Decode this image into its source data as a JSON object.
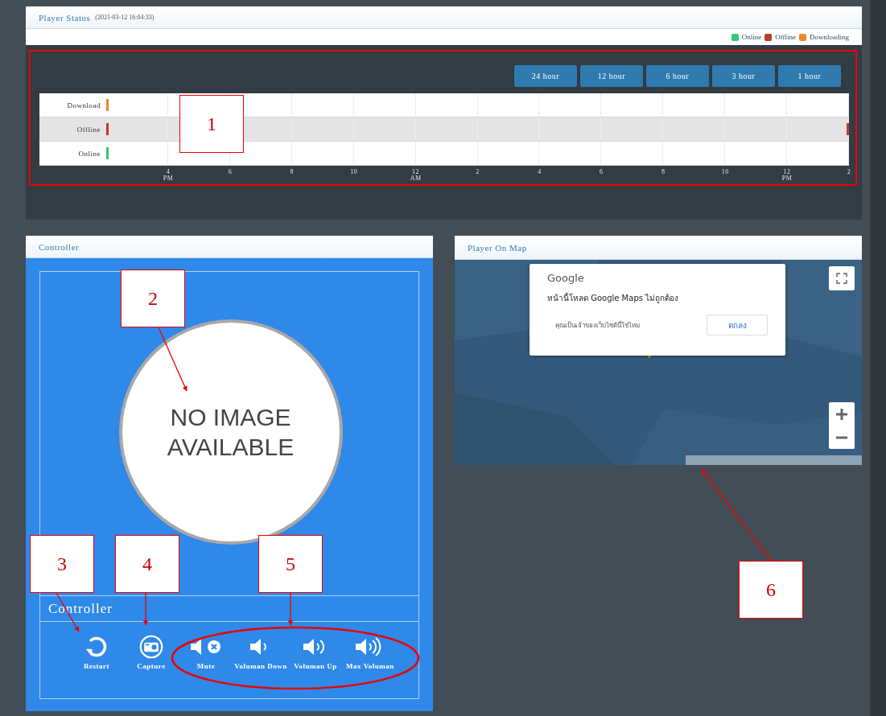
{
  "status_panel": {
    "title": "Player Status",
    "timestamp": "(2021-03-12 16:04:33)",
    "legend": [
      {
        "label": "Online",
        "color": "#2ecc71"
      },
      {
        "label": "Offline",
        "color": "#c0392b"
      },
      {
        "label": "Downloading",
        "color": "#f0882a"
      }
    ],
    "ranges": [
      "24 hour",
      "12 hour",
      "6 hour",
      "3 hour",
      "1 hour"
    ],
    "timeline": {
      "rows": [
        {
          "label": "Download",
          "color": "#f0882a",
          "shaded": false,
          "end_mark": false
        },
        {
          "label": "Offline",
          "color": "#c0392b",
          "shaded": true,
          "end_mark": true
        },
        {
          "label": "Online",
          "color": "#2ecc71",
          "shaded": false,
          "end_mark": false
        }
      ],
      "ticks": [
        {
          "label": "4",
          "period": "PM"
        },
        {
          "label": "6"
        },
        {
          "label": "8"
        },
        {
          "label": "10"
        },
        {
          "label": "12",
          "period": "AM"
        },
        {
          "label": "2"
        },
        {
          "label": "4"
        },
        {
          "label": "6"
        },
        {
          "label": "8"
        },
        {
          "label": "10"
        },
        {
          "label": "12",
          "period": "PM"
        },
        {
          "label": "2"
        }
      ]
    }
  },
  "controller": {
    "title": "Controller",
    "image_placeholder": "NO IMAGE AVAILABLE",
    "section_title": "Controller",
    "buttons": [
      {
        "kind": "restart",
        "label": "Restart"
      },
      {
        "kind": "capture",
        "label": "Capture"
      },
      {
        "kind": "mute",
        "label": "Mute"
      },
      {
        "kind": "volume_down",
        "label": "Voluman Down"
      },
      {
        "kind": "volume_up",
        "label": "Voluman Up"
      },
      {
        "kind": "volume_max",
        "label": "Max Voluman"
      }
    ]
  },
  "map_panel": {
    "title": "Player On Map",
    "dialog": {
      "brand": "Google",
      "message": "หน้านี้โหลด Google Maps ไม่ถูกต้อง",
      "question": "คุณเป็นเจ้าของเว็บไซต์นี้ใช่ไหม",
      "button": "ตกลง"
    }
  },
  "annotations": [
    {
      "label": "1"
    },
    {
      "label": "2"
    },
    {
      "label": "3"
    },
    {
      "label": "4"
    },
    {
      "label": "5"
    },
    {
      "label": "6"
    }
  ]
}
